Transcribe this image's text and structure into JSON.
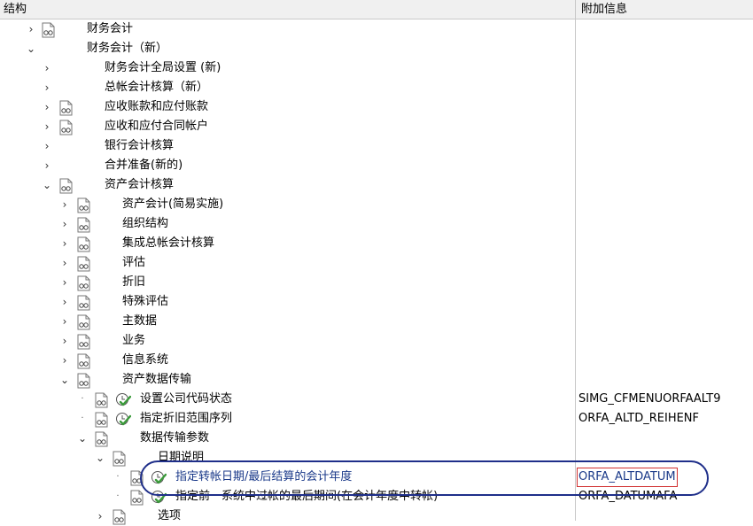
{
  "header": {
    "col_structure": "结构",
    "col_info": "附加信息"
  },
  "rows": [
    {
      "label": "财务会计",
      "toggle": "expand",
      "info": ""
    },
    {
      "label": "财务会计（新）",
      "toggle": "collapse",
      "info": ""
    },
    {
      "label": "财务会计全局设置 (新)",
      "toggle": "expand",
      "info": ""
    },
    {
      "label": "总帐会计核算（新）",
      "toggle": "expand",
      "info": ""
    },
    {
      "label": "应收账款和应付账款",
      "toggle": "expand",
      "info": ""
    },
    {
      "label": "应收和应付合同帐户",
      "toggle": "expand",
      "info": ""
    },
    {
      "label": "银行会计核算",
      "toggle": "expand",
      "info": ""
    },
    {
      "label": "合并准备(新的)",
      "toggle": "expand",
      "info": ""
    },
    {
      "label": "资产会计核算",
      "toggle": "collapse",
      "info": ""
    },
    {
      "label": "资产会计(简易实施)",
      "toggle": "expand",
      "info": ""
    },
    {
      "label": "组织结构",
      "toggle": "expand",
      "info": ""
    },
    {
      "label": "集成总帐会计核算",
      "toggle": "expand",
      "info": ""
    },
    {
      "label": "评估",
      "toggle": "expand",
      "info": ""
    },
    {
      "label": "折旧",
      "toggle": "expand",
      "info": ""
    },
    {
      "label": "特殊评估",
      "toggle": "expand",
      "info": ""
    },
    {
      "label": "主数据",
      "toggle": "expand",
      "info": ""
    },
    {
      "label": "业务",
      "toggle": "expand",
      "info": ""
    },
    {
      "label": "信息系统",
      "toggle": "expand",
      "info": ""
    },
    {
      "label": "资产数据传输",
      "toggle": "collapse",
      "info": ""
    },
    {
      "label": "设置公司代码状态",
      "toggle": "leaf",
      "info": "SIMG_CFMENUORFAALT9"
    },
    {
      "label": "指定折旧范围序列",
      "toggle": "leaf",
      "info": "ORFA_ALTD_REIHENF"
    },
    {
      "label": "数据传输参数",
      "toggle": "collapse",
      "info": ""
    },
    {
      "label": "日期说明",
      "toggle": "collapse",
      "info": ""
    },
    {
      "label": "指定转帐日期/最后结算的会计年度",
      "toggle": "leaf",
      "info": "ORFA_ALTDATUM"
    },
    {
      "label": "指定前一系统中过帐的最后期间(在会计年度中转帐)",
      "toggle": "leaf",
      "info": "ORFA_DATUMAFA"
    },
    {
      "label": "选项",
      "toggle": "expand",
      "info": ""
    }
  ],
  "glyphs": {
    "expand": "›",
    "collapse": "⌄",
    "leaf": "·"
  },
  "colors": {
    "selected_text": "#1b3a8a",
    "callout": "#1f2f8a",
    "info_box": "#d13030",
    "check": "#3a9a3a"
  }
}
